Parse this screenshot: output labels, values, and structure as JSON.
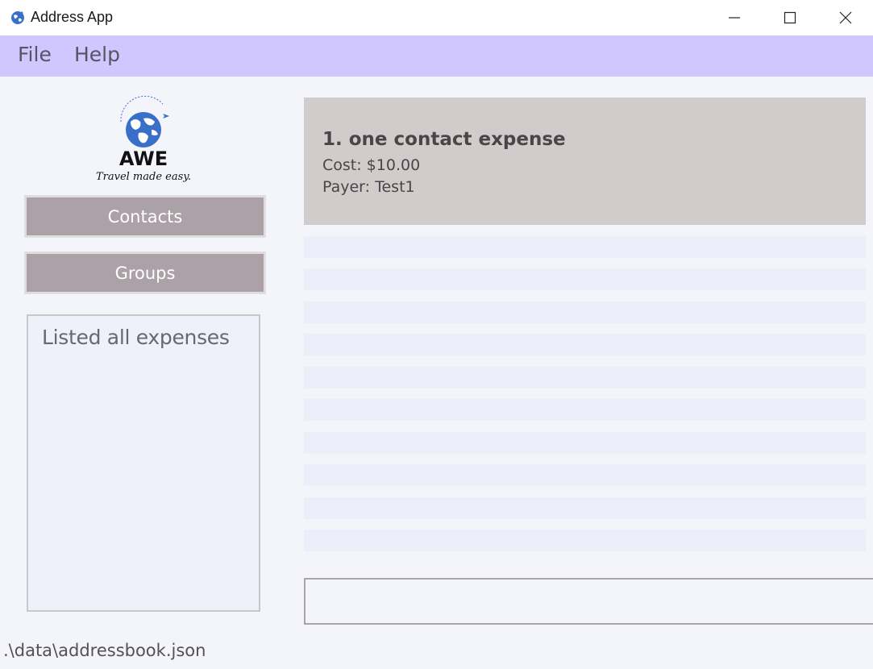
{
  "window": {
    "title": "Address App",
    "icon": "globe-icon",
    "controls": [
      "minimize-icon",
      "maximize-icon",
      "close-icon"
    ]
  },
  "menu": {
    "items": [
      {
        "label": "File"
      },
      {
        "label": "Help"
      }
    ]
  },
  "sidebar": {
    "logo": {
      "brand": "AWE",
      "tagline": "Travel made easy."
    },
    "buttons": {
      "contacts": "Contacts",
      "groups": "Groups"
    },
    "result_message": "Listed all expenses"
  },
  "expenses": {
    "items": [
      {
        "title": "1. one contact expense",
        "cost": "Cost: $10.00",
        "payer": "Payer: Test1"
      }
    ]
  },
  "command_box": {
    "value": ""
  },
  "status_bar": {
    "path": ".\\data\\addressbook.json"
  },
  "colors": {
    "menubar": "#d0c7ff",
    "button": "#ada1a8",
    "card": "#d1cbcb",
    "background": "#f4f5fb"
  }
}
